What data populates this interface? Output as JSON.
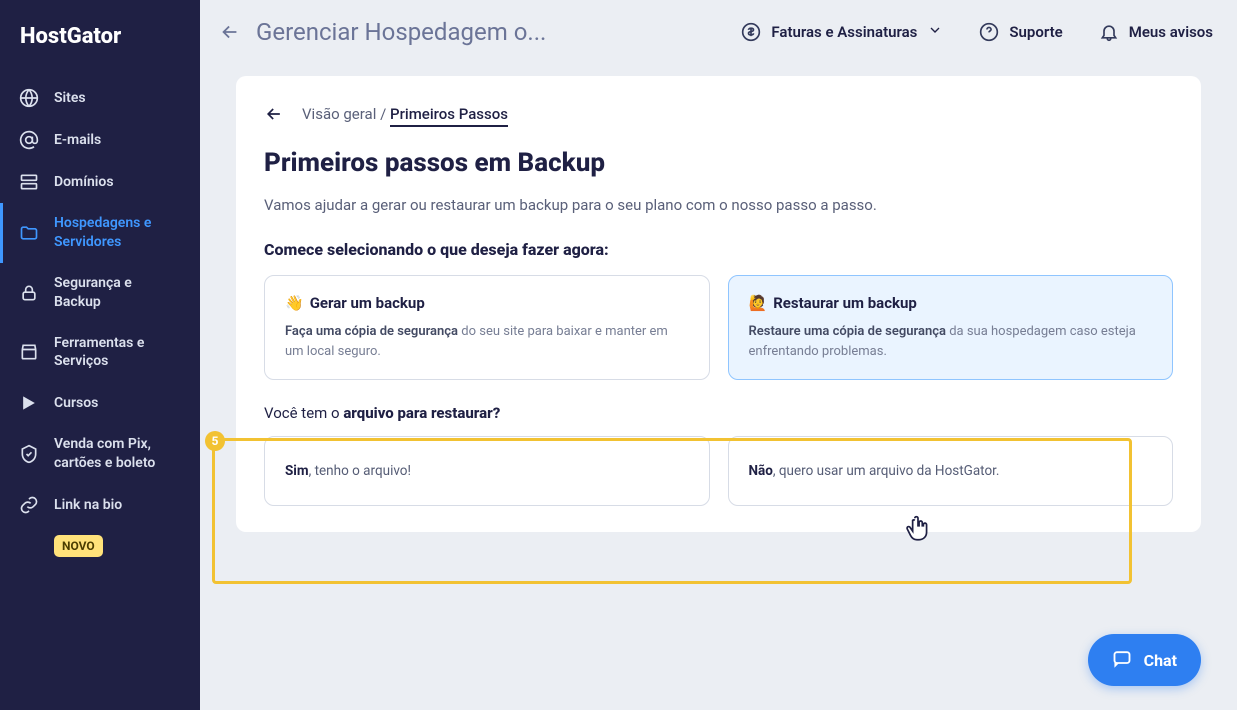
{
  "brand": "HostGator",
  "sidebar": {
    "items": [
      {
        "label": "Sites",
        "icon": "globe-icon"
      },
      {
        "label": "E-mails",
        "icon": "at-icon"
      },
      {
        "label": "Domínios",
        "icon": "server-icon"
      },
      {
        "label": "Hospedagens e Servidores",
        "icon": "folder-icon"
      },
      {
        "label": "Segurança e Backup",
        "icon": "lock-icon"
      },
      {
        "label": "Ferramentas e Serviços",
        "icon": "storefront-icon"
      },
      {
        "label": "Cursos",
        "icon": "play-icon"
      },
      {
        "label": "Venda com Pix, cartões e boleto",
        "icon": "shield-icon"
      },
      {
        "label": "Link na bio",
        "icon": "link-icon",
        "badge": "NOVO"
      }
    ]
  },
  "topbar": {
    "title": "Gerenciar Hospedagem o...",
    "actions": {
      "billing": "Faturas e Assinaturas",
      "support": "Suporte",
      "notices": "Meus avisos"
    }
  },
  "breadcrumb": {
    "parent": "Visão geral",
    "sep": "/",
    "current": "Primeiros Passos"
  },
  "page": {
    "heading": "Primeiros passos em Backup",
    "intro": "Vamos ajudar a gerar ou restaurar um backup para o seu plano com o nosso passo a passo.",
    "select_prompt": "Comece selecionando o que deseja fazer agora:",
    "options": {
      "generate": {
        "emoji": "👋",
        "title": "Gerar um backup",
        "desc_bold": "Faça uma cópia de segurança",
        "desc_rest": " do seu site para baixar e manter em um local seguro."
      },
      "restore": {
        "emoji": "🙋",
        "title": "Restaurar um backup",
        "desc_bold": "Restaure uma cópia de segurança",
        "desc_rest": " da sua hospedagem caso esteja enfrentando problemas."
      }
    },
    "question2_pre": "Você tem o ",
    "question2_bold": "arquivo para restaurar?",
    "answers": {
      "yes_bold": "Sim",
      "yes_rest": ", tenho o arquivo!",
      "no_bold": "Não",
      "no_rest": ", quero usar um arquivo da HostGator."
    },
    "callout_number": "5"
  },
  "chat": {
    "label": "Chat"
  }
}
